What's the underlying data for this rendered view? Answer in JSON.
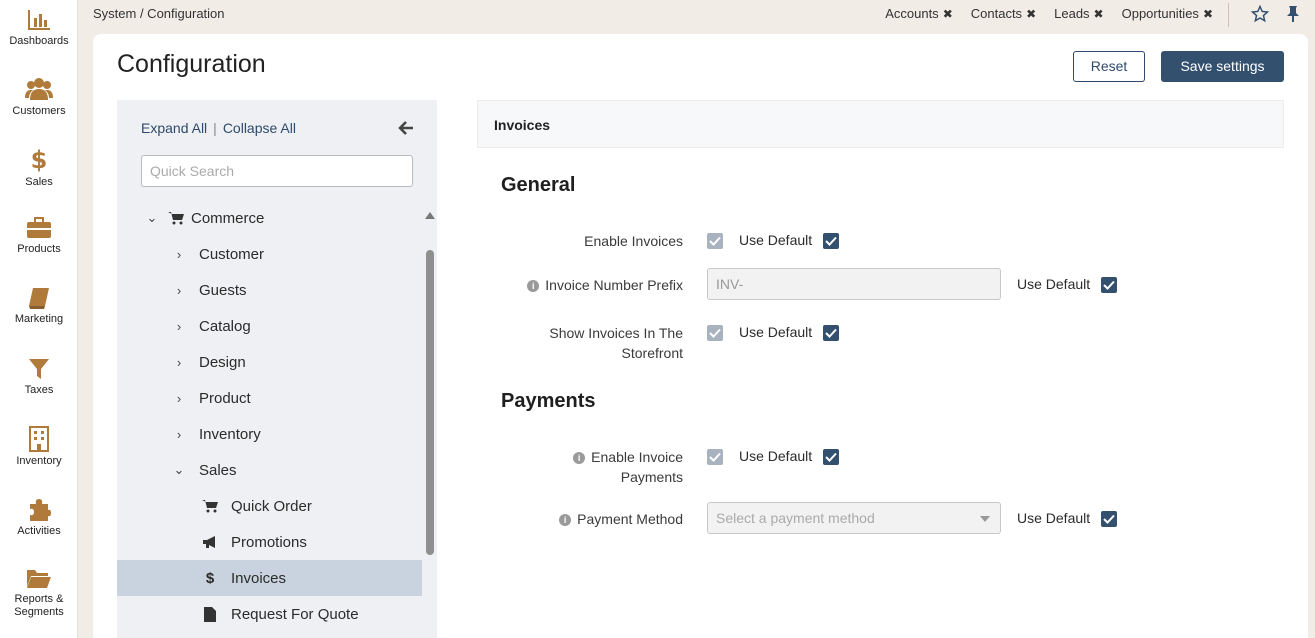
{
  "sidebar": {
    "items": [
      {
        "label": "Dashboards",
        "icon": "bar-chart-icon"
      },
      {
        "label": "Customers",
        "icon": "users-icon"
      },
      {
        "label": "Sales",
        "icon": "dollar-icon"
      },
      {
        "label": "Products",
        "icon": "briefcase-icon"
      },
      {
        "label": "Marketing",
        "icon": "book-icon"
      },
      {
        "label": "Taxes",
        "icon": "filter-icon"
      },
      {
        "label": "Inventory",
        "icon": "building-icon"
      },
      {
        "label": "Activities",
        "icon": "puzzle-icon"
      },
      {
        "label": "Reports &",
        "label2": "Segments",
        "icon": "folder-icon"
      }
    ]
  },
  "topbar": {
    "breadcrumb": "System / Configuration",
    "pins": [
      "Accounts",
      "Contacts",
      "Leads",
      "Opportunities"
    ]
  },
  "header": {
    "title": "Configuration",
    "reset_label": "Reset",
    "save_label": "Save settings"
  },
  "tree": {
    "expand_all": "Expand All",
    "collapse_all": "Collapse All",
    "search_placeholder": "Quick Search",
    "items": [
      {
        "label": "Commerce",
        "level": 0,
        "state": "expanded",
        "icon": "cart-icon"
      },
      {
        "label": "Customer",
        "level": 1,
        "state": "collapsed"
      },
      {
        "label": "Guests",
        "level": 1,
        "state": "collapsed"
      },
      {
        "label": "Catalog",
        "level": 1,
        "state": "collapsed"
      },
      {
        "label": "Design",
        "level": 1,
        "state": "collapsed"
      },
      {
        "label": "Product",
        "level": 1,
        "state": "collapsed"
      },
      {
        "label": "Inventory",
        "level": 1,
        "state": "collapsed"
      },
      {
        "label": "Sales",
        "level": 1,
        "state": "expanded"
      },
      {
        "label": "Quick Order",
        "level": 2,
        "icon": "cart-icon"
      },
      {
        "label": "Promotions",
        "level": 2,
        "icon": "megaphone-icon"
      },
      {
        "label": "Invoices",
        "level": 2,
        "icon": "dollar-icon",
        "selected": true
      },
      {
        "label": "Request For Quote",
        "level": 2,
        "icon": "file-icon"
      }
    ]
  },
  "content": {
    "section_title": "Invoices",
    "general": {
      "title": "General",
      "enable_invoices": "Enable Invoices",
      "invoice_prefix_label": "Invoice Number Prefix",
      "invoice_prefix_value": "INV-",
      "show_invoices_line1": "Show Invoices In The",
      "show_invoices_line2": "Storefront"
    },
    "payments": {
      "title": "Payments",
      "enable_payments_line1": "Enable Invoice",
      "enable_payments_line2": "Payments",
      "payment_method_label": "Payment Method",
      "payment_method_placeholder": "Select a payment method"
    },
    "use_default": "Use Default"
  },
  "colors": {
    "accent": "#34506f",
    "background": "#f1ece6",
    "sidebar_icon": "#b07a3a",
    "selected_row": "#c9d3df"
  }
}
